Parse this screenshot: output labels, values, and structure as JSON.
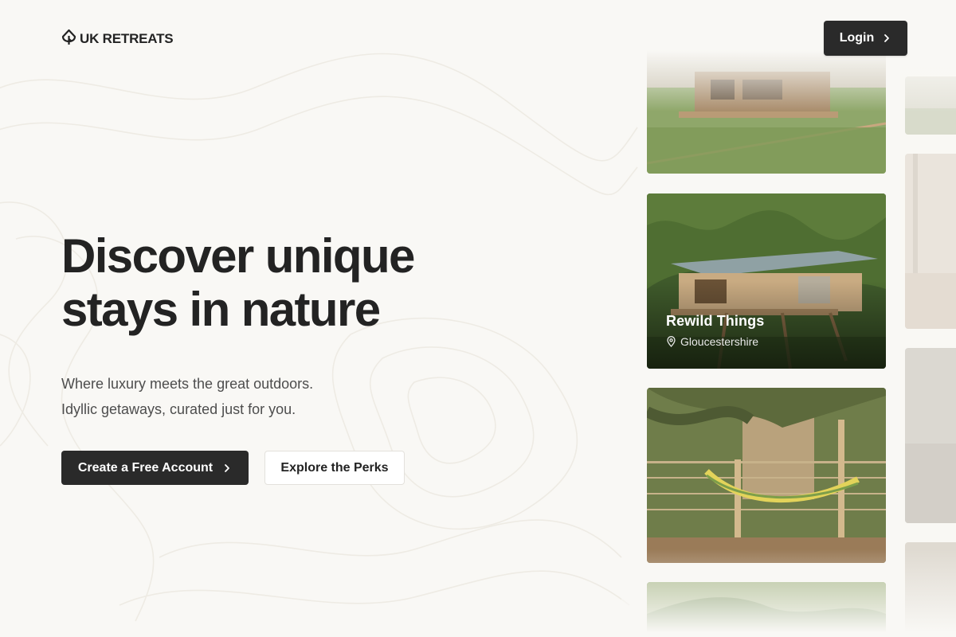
{
  "brand": {
    "name": "UK RETREATS",
    "icon": "tree-pin-icon"
  },
  "header": {
    "login_label": "Login"
  },
  "hero": {
    "headline_line1": "Discover unique",
    "headline_line2": "stays in nature",
    "sub_line1": "Where luxury meets the great outdoors.",
    "sub_line2": "Idyllic getaways, curated just for you."
  },
  "cta": {
    "primary_label": "Create a Free Account",
    "secondary_label": "Explore the Perks"
  },
  "featured_card": {
    "title": "Rewild Things",
    "location": "Gloucestershire",
    "location_icon": "map-pin-icon"
  },
  "colors": {
    "background": "#f9f8f5",
    "primary_button": "#2a2a2a",
    "text": "#232323"
  }
}
